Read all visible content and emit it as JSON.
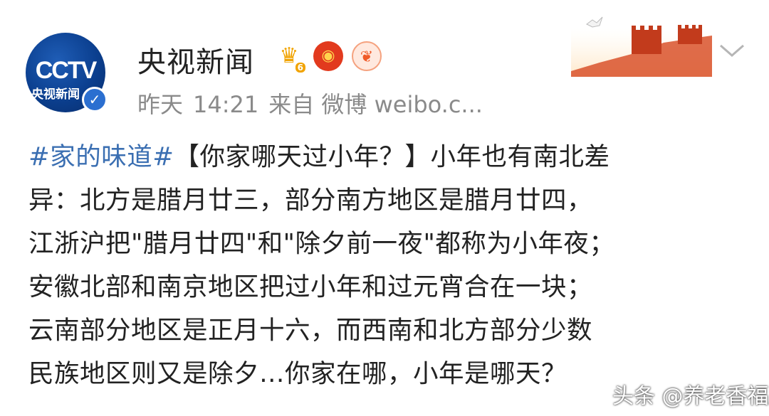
{
  "user": {
    "avatar_logo": "CCTV",
    "avatar_sub": "央视新闻",
    "name": "央视新闻",
    "badge_level": "6",
    "verified_icon": "verified-icon"
  },
  "meta": {
    "time_label": "昨天",
    "time": "14:21",
    "source": "来自 微博 weibo.c..."
  },
  "post": {
    "hashtag": "#家的味道#",
    "lines": [
      "【你家哪天过小年？】小年也有南北差",
      "异：北方是腊月廿三，部分南方地区是腊月廿四，",
      "江浙沪把\"腊月廿四\"和\"除夕前一夜\"都称为小年夜；",
      "安徽北部和南京地区把过小年和过元宵合在一块；",
      "云南部分地区是正月十六，而西南和北方部分少数",
      "民族地区则又是除夕…你家在哪，小年是哪天？"
    ]
  },
  "watermark": "头条 @养老香福居",
  "colors": {
    "hashtag": "#3b6fb2",
    "meta": "#8a8a8a",
    "verified": "#2b6fd0"
  }
}
